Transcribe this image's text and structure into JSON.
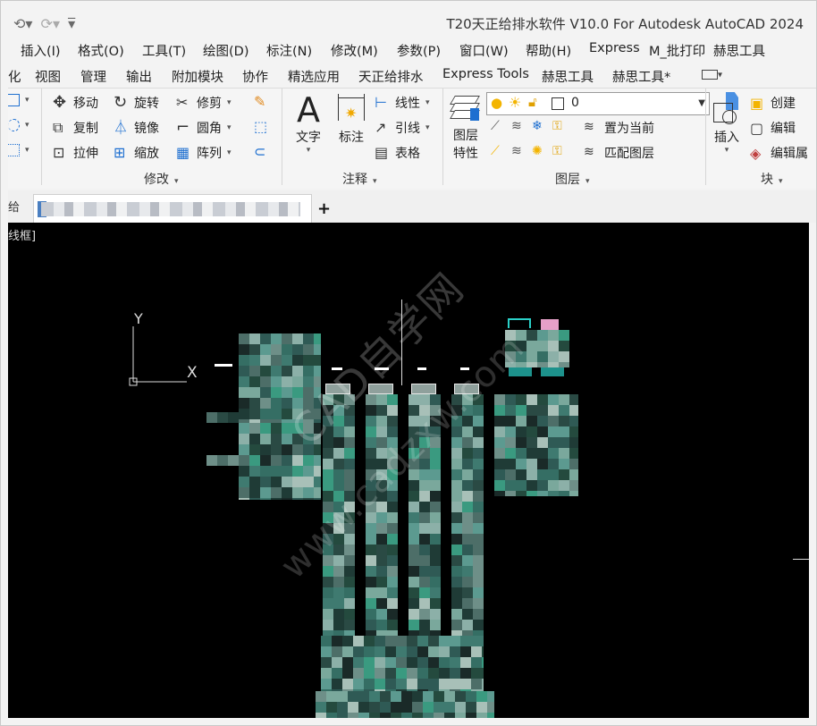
{
  "window": {
    "title": "T20天正给排水软件 V10.0 For Autodesk AutoCAD 2024"
  },
  "quick_access": {
    "undo_icon": "undo-icon",
    "redo_icon": "redo-icon",
    "customize_icon": "customize-qat-icon"
  },
  "menu": {
    "items": [
      "插入(I)",
      "格式(O)",
      "工具(T)",
      "绘图(D)",
      "标注(N)",
      "修改(M)",
      "参数(P)",
      "窗口(W)",
      "帮助(H)",
      "Express",
      "M_批打印",
      "赫思工具"
    ]
  },
  "ribbon_tabs": {
    "items": [
      "化",
      "视图",
      "管理",
      "输出",
      "附加模块",
      "协作",
      "精选应用",
      "天正给排水",
      "Express Tools",
      "赫思工具",
      "赫思工具*"
    ]
  },
  "ribbon": {
    "modify": {
      "move": "移动",
      "rotate": "旋转",
      "trim": "修剪",
      "copy": "复制",
      "mirror": "镜像",
      "fillet": "圆角",
      "stretch": "拉伸",
      "scale": "缩放",
      "array": "阵列",
      "panel_label": "修改"
    },
    "annotation": {
      "text": "文字",
      "dimension": "标注",
      "linear": "线性",
      "leader": "引线",
      "table": "表格",
      "panel_label": "注释"
    },
    "layers": {
      "properties_line1": "图层",
      "properties_line2": "特性",
      "current_layer": "0",
      "set_current": "置为当前",
      "match_layer": "匹配图层",
      "panel_label": "图层"
    },
    "block": {
      "insert": "插入",
      "create": "创建",
      "edit": "编辑",
      "edit_attributes": "编辑属",
      "panel_label": "块"
    }
  },
  "doc_tabs": {
    "start_tab": "给",
    "new_tab": "+"
  },
  "canvas": {
    "viewport_label": "线框]",
    "ucs_y": "Y",
    "ucs_x": "X",
    "watermark_cn": "CAD自学网",
    "watermark_url": "www.cadzxw.com"
  },
  "colors": {
    "canvas_bg": "#000000",
    "ribbon_bg": "#f5f5f5",
    "accent_cyan": "#2ad0c8"
  }
}
